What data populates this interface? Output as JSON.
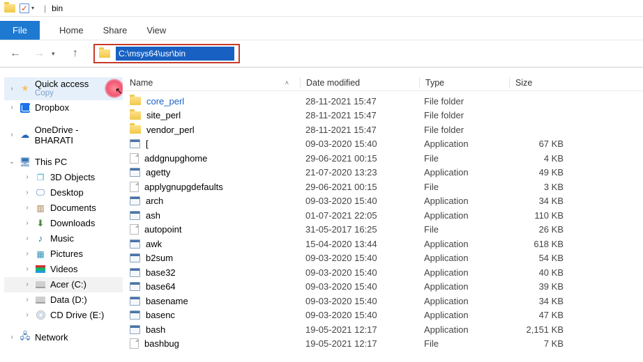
{
  "window": {
    "title": "bin"
  },
  "ribbon": {
    "file": "File",
    "tabs": [
      "Home",
      "Share",
      "View"
    ]
  },
  "address": {
    "path": "C:\\msys64\\usr\\bin"
  },
  "sidebar": {
    "quick_access": {
      "label": "Quick access",
      "copy": "Copy"
    },
    "dropbox": "Dropbox",
    "onedrive": "OneDrive - BHARATI",
    "this_pc": "This PC",
    "pc_children": [
      {
        "label": "3D Objects",
        "icon": "3d"
      },
      {
        "label": "Desktop",
        "icon": "desk"
      },
      {
        "label": "Documents",
        "icon": "doc"
      },
      {
        "label": "Downloads",
        "icon": "dl"
      },
      {
        "label": "Music",
        "icon": "music"
      },
      {
        "label": "Pictures",
        "icon": "pic"
      },
      {
        "label": "Videos",
        "icon": "vid"
      },
      {
        "label": "Acer (C:)",
        "icon": "drive",
        "selected": true
      },
      {
        "label": "Data (D:)",
        "icon": "drive"
      },
      {
        "label": "CD Drive (E:)",
        "icon": "cd"
      }
    ],
    "network": "Network"
  },
  "columns": {
    "name": "Name",
    "date": "Date modified",
    "type": "Type",
    "size": "Size"
  },
  "rows": [
    {
      "icon": "folder",
      "name": "core_perl",
      "date": "28-11-2021 15:47",
      "type": "File folder",
      "size": ""
    },
    {
      "icon": "folder",
      "name": "site_perl",
      "date": "28-11-2021 15:47",
      "type": "File folder",
      "size": ""
    },
    {
      "icon": "folder",
      "name": "vendor_perl",
      "date": "28-11-2021 15:47",
      "type": "File folder",
      "size": ""
    },
    {
      "icon": "app",
      "name": "[",
      "date": "09-03-2020 15:40",
      "type": "Application",
      "size": "67 KB"
    },
    {
      "icon": "file",
      "name": "addgnupghome",
      "date": "29-06-2021 00:15",
      "type": "File",
      "size": "4 KB"
    },
    {
      "icon": "app",
      "name": "agetty",
      "date": "21-07-2020 13:23",
      "type": "Application",
      "size": "49 KB"
    },
    {
      "icon": "file",
      "name": "applygnupgdefaults",
      "date": "29-06-2021 00:15",
      "type": "File",
      "size": "3 KB"
    },
    {
      "icon": "app",
      "name": "arch",
      "date": "09-03-2020 15:40",
      "type": "Application",
      "size": "34 KB"
    },
    {
      "icon": "app",
      "name": "ash",
      "date": "01-07-2021 22:05",
      "type": "Application",
      "size": "110 KB"
    },
    {
      "icon": "file",
      "name": "autopoint",
      "date": "31-05-2017 16:25",
      "type": "File",
      "size": "26 KB"
    },
    {
      "icon": "app",
      "name": "awk",
      "date": "15-04-2020 13:44",
      "type": "Application",
      "size": "618 KB"
    },
    {
      "icon": "app",
      "name": "b2sum",
      "date": "09-03-2020 15:40",
      "type": "Application",
      "size": "54 KB"
    },
    {
      "icon": "app",
      "name": "base32",
      "date": "09-03-2020 15:40",
      "type": "Application",
      "size": "40 KB"
    },
    {
      "icon": "app",
      "name": "base64",
      "date": "09-03-2020 15:40",
      "type": "Application",
      "size": "39 KB"
    },
    {
      "icon": "app",
      "name": "basename",
      "date": "09-03-2020 15:40",
      "type": "Application",
      "size": "34 KB"
    },
    {
      "icon": "app",
      "name": "basenc",
      "date": "09-03-2020 15:40",
      "type": "Application",
      "size": "47 KB"
    },
    {
      "icon": "app",
      "name": "bash",
      "date": "19-05-2021 12:17",
      "type": "Application",
      "size": "2,151 KB"
    },
    {
      "icon": "file",
      "name": "bashbug",
      "date": "19-05-2021 12:17",
      "type": "File",
      "size": "7 KB"
    }
  ]
}
